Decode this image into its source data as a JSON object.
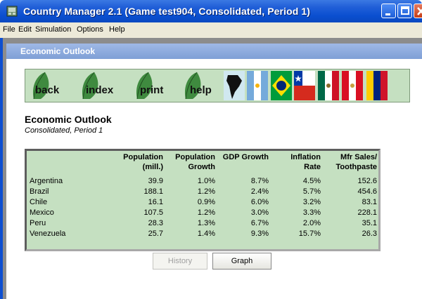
{
  "window": {
    "title": "Country Manager 2.1 (Game test904, Consolidated, Period 1)"
  },
  "menu": [
    "File",
    "Edit",
    "Simulation",
    "Options",
    "Help"
  ],
  "child_window": {
    "title": "Economic Outlook"
  },
  "nav": {
    "back": "back",
    "index": "index",
    "print": "print",
    "help": "help"
  },
  "flags": [
    "south-america-map-icon",
    "argentina-flag-icon",
    "brazil-flag-icon",
    "chile-flag-icon",
    "mexico-flag-icon",
    "peru-flag-icon",
    "venezuela-flag-icon"
  ],
  "page": {
    "heading": "Economic Outlook",
    "subheading": "Consolidated, Period 1"
  },
  "table": {
    "headers": [
      {
        "line1": "Population",
        "line2": "(mill.)"
      },
      {
        "line1": "Population",
        "line2": "Growth"
      },
      {
        "line1": "GDP Growth",
        "line2": ""
      },
      {
        "line1": "Inflation",
        "line2": "Rate"
      },
      {
        "line1": "Mfr Sales/",
        "line2": "Toothpaste"
      }
    ],
    "rows": [
      {
        "country": "Argentina",
        "population": "39.9",
        "pop_growth": "1.0%",
        "gdp_growth": "8.7%",
        "inflation": "4.5%",
        "mfr_sales": "152.6"
      },
      {
        "country": "Brazil",
        "population": "188.1",
        "pop_growth": "1.2%",
        "gdp_growth": "2.4%",
        "inflation": "5.7%",
        "mfr_sales": "454.6"
      },
      {
        "country": "Chile",
        "population": "16.1",
        "pop_growth": "0.9%",
        "gdp_growth": "6.0%",
        "inflation": "3.2%",
        "mfr_sales": "83.1"
      },
      {
        "country": "Mexico",
        "population": "107.5",
        "pop_growth": "1.2%",
        "gdp_growth": "3.0%",
        "inflation": "3.3%",
        "mfr_sales": "228.1"
      },
      {
        "country": "Peru",
        "population": "28.3",
        "pop_growth": "1.3%",
        "gdp_growth": "6.7%",
        "inflation": "2.0%",
        "mfr_sales": "35.1"
      },
      {
        "country": "Venezuela",
        "population": "25.7",
        "pop_growth": "1.4%",
        "gdp_growth": "9.3%",
        "inflation": "15.7%",
        "mfr_sales": "26.3"
      }
    ]
  },
  "buttons": {
    "history": "History",
    "graph": "Graph"
  },
  "colors": {
    "titlebar": "#0a4fd0",
    "panel_green": "#c5e0c1",
    "leaf_green": "#3f8a3f"
  }
}
